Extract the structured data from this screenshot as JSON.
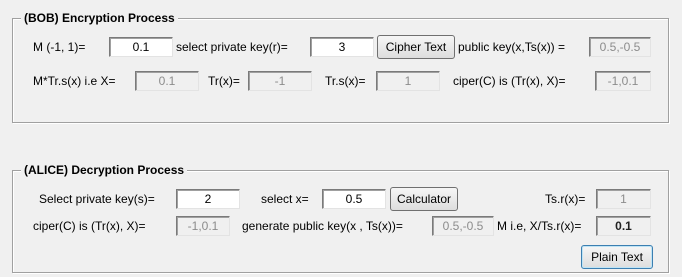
{
  "bob": {
    "title": "(BOB) Encryption Process",
    "m_label": "M (-1, 1)=",
    "m_value": "0.1",
    "private_key_label": "select private key(r)=",
    "private_key_value": "3",
    "cipher_button": "Cipher Text",
    "public_key_label": "public key(x,Ts(x)) =",
    "public_key_value": "0.5,-0.5",
    "mtrs_label": "M*Tr.s(x) i.e X=",
    "mtrs_value": "0.1",
    "tr_label": "Tr(x)=",
    "tr_value": "-1",
    "trs_label": "Tr.s(x)=",
    "trs_value": "1",
    "cipher_label": "ciper(C) is (Tr(x), X)=",
    "cipher_value": "-1,0.1"
  },
  "alice": {
    "title": "(ALICE) Decryption Process",
    "private_key_label": "Select private key(s)=",
    "private_key_value": "2",
    "x_label": "select x=",
    "x_value": "0.5",
    "calculator_button": "Calculator",
    "tsr_label": "Ts.r(x)=",
    "tsr_value": "1",
    "cipher_label": "ciper(C) is (Tr(x), X)=",
    "cipher_value": "-1,0.1",
    "gen_public_label": "generate public key(x , Ts(x))=",
    "gen_public_value": "0.5,-0.5",
    "mie_label": "M i.e, X/Ts.r(x)=",
    "mie_value": "0.1",
    "plain_button": "Plain Text"
  }
}
